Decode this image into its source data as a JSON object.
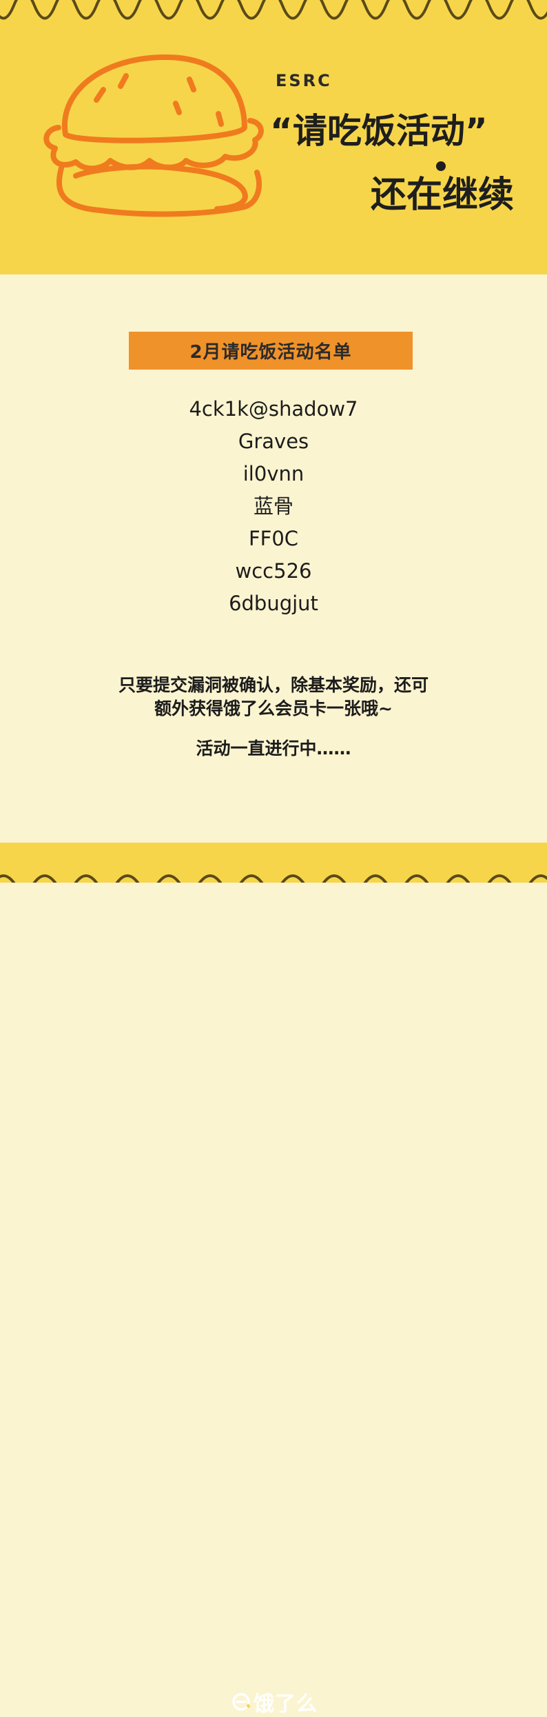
{
  "hero": {
    "brand": "ESRC",
    "title_line1": "“请吃饭活动”",
    "title_line2": "还在继续",
    "illustration": "burger-icon"
  },
  "list": {
    "heading": "2月请吃饭活动名单",
    "names": [
      "4ck1k@shadow7",
      "Graves",
      "il0vnn",
      "蓝骨",
      "FF0C",
      "wcc526",
      "6dbugjut"
    ]
  },
  "notes": {
    "line1": "只要提交漏洞被确认，除基本奖励，还可",
    "line2": "额外获得饿了么会员卡一张哦~",
    "line3": "活动一直进行中……"
  },
  "footer": {
    "logo_text": "饿了么",
    "logo_icon": "eleme-logo-icon"
  },
  "colors": {
    "hero_bg": "#F6D54A",
    "page_bg": "#FBF4D0",
    "accent_orange": "#F0922A",
    "wave_dark": "#5A4A1A",
    "burger_stroke": "#F07A1E"
  }
}
